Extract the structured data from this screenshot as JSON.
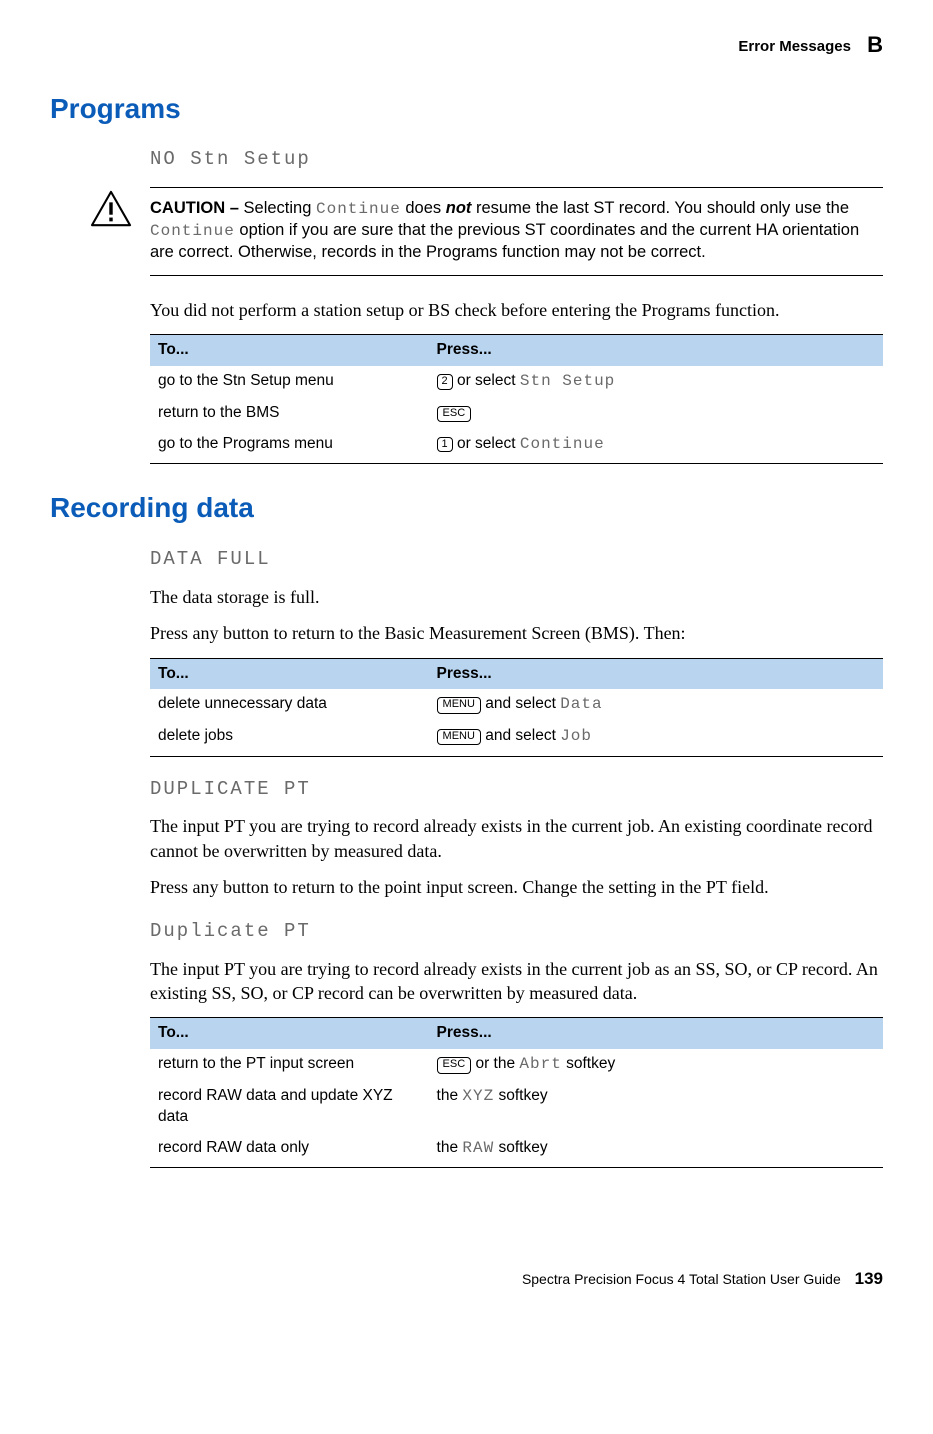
{
  "header": {
    "section": "Error Messages",
    "appendix": "B"
  },
  "programs": {
    "heading": "Programs",
    "lcd_heading": "NO Stn Setup",
    "caution_label": "CAUTION – ",
    "caution_text_1": "Selecting ",
    "caution_continue": "Continue",
    "caution_text_2": " does ",
    "caution_not": "not",
    "caution_text_3": " resume the last ST record. You should only use the ",
    "caution_text_4": " option if you are sure that the previous ST coordinates and the current HA orientation are correct. Otherwise, records in the Programs function may not be correct.",
    "body": "You did not perform a station setup or BS check before entering the Programs function.",
    "table": {
      "headers": [
        "To...",
        "Press..."
      ],
      "rows": [
        {
          "to": "go to the Stn Setup menu",
          "key": "2",
          "mid": " or select ",
          "lcd": "Stn Setup"
        },
        {
          "to": "return to the BMS",
          "key": "ESC",
          "mid": "",
          "lcd": ""
        },
        {
          "to": "go to the Programs menu",
          "key": "1",
          "mid": " or select ",
          "lcd": "Continue"
        }
      ]
    }
  },
  "recording": {
    "heading": "Recording data",
    "data_full": {
      "lcd": "DATA FULL",
      "body1": "The data storage is full.",
      "body2": "Press any button to return to the Basic Measurement Screen (BMS). Then:",
      "table": {
        "headers": [
          "To...",
          "Press..."
        ],
        "rows": [
          {
            "to": "delete unnecessary data",
            "key": "MENU",
            "mid": " and select  ",
            "lcd": "Data"
          },
          {
            "to": "delete jobs",
            "key": "MENU",
            "mid": " and select  ",
            "lcd": "Job"
          }
        ]
      }
    },
    "dup_pt_upper": {
      "lcd": "DUPLICATE PT",
      "body1": "The input PT you are trying to record already exists in the current job. An existing coordinate record cannot be overwritten by measured data.",
      "body2": "Press any button to return to the point input screen. Change the setting in the PT field."
    },
    "dup_pt_mixed": {
      "lcd": "Duplicate PT",
      "body1": "The input PT you are trying to record already exists in the current job as an SS, SO, or CP record. An existing SS, SO, or CP record can be overwritten by measured data.",
      "table": {
        "headers": [
          "To...",
          "Press..."
        ],
        "rows": [
          {
            "to": "return to the PT input screen",
            "pre_key": "ESC",
            "mid": " or the ",
            "lcd": "Abrt",
            "post": " softkey"
          },
          {
            "to": "record RAW data and update XYZ data",
            "pre": "the ",
            "lcd": "XYZ",
            "post": " softkey"
          },
          {
            "to": "record RAW data only",
            "pre": "the ",
            "lcd": "RAW",
            "post": " softkey"
          }
        ]
      }
    }
  },
  "footer": {
    "title": "Spectra Precision Focus 4 Total Station User Guide",
    "page": "139"
  }
}
